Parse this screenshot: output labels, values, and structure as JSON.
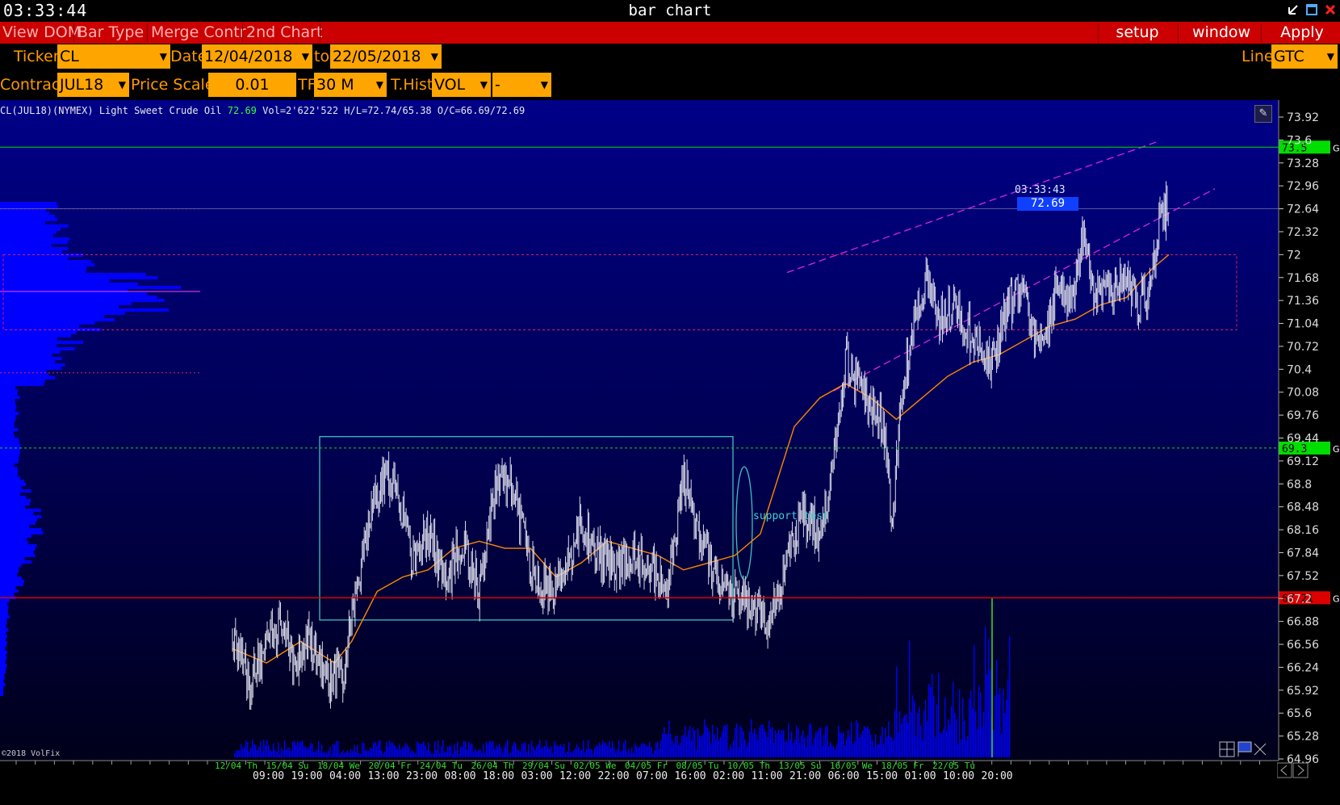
{
  "titlebar": {
    "clock": "03:33:44",
    "title": "bar chart"
  },
  "menubar": {
    "left_items": [
      "View DOM",
      "Bar Type",
      "Merge Contr",
      "2nd Chart"
    ],
    "setup_label": "setup",
    "window_label": "window",
    "apply_label": "Apply"
  },
  "controls": {
    "ticker_label": "Ticker",
    "ticker_value": "CL",
    "date_label": "Date",
    "date_from": "12/04/2018",
    "to_label": "to",
    "date_to": "22/05/2018",
    "line_label": "Line",
    "line_value": "GTC",
    "contract_label": "Contract",
    "contract_value": "JUL18",
    "price_scale_label": "Price Scale",
    "price_scale_value": "0.01",
    "tf_label": "TF",
    "tf_value": "30 M",
    "thist_label": "T.Hist",
    "thist_value": "VOL",
    "extra_value": "-"
  },
  "chart": {
    "info": {
      "symbol": "CL(JUL18)(NYMEX) Light Sweet Crude Oil",
      "last": "72.69",
      "rest": "Vol=2'622'522 H/L=72.74/65.38 O/C=66.69/72.69"
    },
    "copyright": "©2018 VolFix",
    "annotation": "support test",
    "last_time": "03:33:43",
    "last_price": "72.69",
    "colors": {
      "background_top": "#000080",
      "background_bottom": "#000018",
      "price": "#d8d8e8",
      "ma": "#ff8800",
      "volume": "#0000ff",
      "profile": "#0000ff",
      "box": "#40c0c0",
      "channel": "#dd22dd",
      "level_green": "#00dd00",
      "level_red": "#dd0000"
    }
  },
  "chart_data": {
    "type": "candlestick",
    "timeframe": "30 M",
    "y_ticks": [
      "73.92",
      "73.6",
      "73.28",
      "72.96",
      "72.64",
      "72.32",
      "72",
      "71.68",
      "71.36",
      "71.04",
      "70.72",
      "70.4",
      "70.08",
      "69.76",
      "69.44",
      "69.12",
      "68.8",
      "68.48",
      "68.16",
      "67.84",
      "67.52",
      "67.2",
      "66.88",
      "66.56",
      "66.24",
      "65.92",
      "65.6",
      "65.28",
      "64.96"
    ],
    "ylim": [
      64.96,
      73.92
    ],
    "x_date_labels": [
      "12/04 Th",
      "15/04 Su",
      "18/04 We",
      "20/04 Fr",
      "24/04 Tu",
      "26/04 Th",
      "29/04 Su",
      "02/05 We",
      "04/05 Fr",
      "08/05 Tu",
      "10/05 Th",
      "13/05 Su",
      "16/05 We",
      "18/05 Fr",
      "22/05 Tu"
    ],
    "x_time_labels": [
      "09:00",
      "19:00",
      "04:00",
      "13:00",
      "23:00",
      "08:00",
      "18:00",
      "03:00",
      "12:00",
      "22:00",
      "07:00",
      "16:00",
      "02:00",
      "11:00",
      "21:00",
      "06:00",
      "15:00",
      "01:00",
      "10:00",
      "20:00"
    ],
    "price_path": [
      [
        0.0,
        66.7
      ],
      [
        0.02,
        66.0
      ],
      [
        0.04,
        66.6
      ],
      [
        0.06,
        66.9
      ],
      [
        0.07,
        66.3
      ],
      [
        0.09,
        66.6
      ],
      [
        0.11,
        66.0
      ],
      [
        0.13,
        66.2
      ],
      [
        0.15,
        67.6
      ],
      [
        0.17,
        68.7
      ],
      [
        0.19,
        69.0
      ],
      [
        0.21,
        67.8
      ],
      [
        0.23,
        68.2
      ],
      [
        0.25,
        67.4
      ],
      [
        0.27,
        68.0
      ],
      [
        0.29,
        67.3
      ],
      [
        0.31,
        68.9
      ],
      [
        0.33,
        68.7
      ],
      [
        0.35,
        67.7
      ],
      [
        0.37,
        67.3
      ],
      [
        0.39,
        67.5
      ],
      [
        0.41,
        68.3
      ],
      [
        0.43,
        67.8
      ],
      [
        0.45,
        67.6
      ],
      [
        0.47,
        67.8
      ],
      [
        0.49,
        67.7
      ],
      [
        0.51,
        67.3
      ],
      [
        0.53,
        68.9
      ],
      [
        0.55,
        68.0
      ],
      [
        0.57,
        67.4
      ],
      [
        0.59,
        67.2
      ],
      [
        0.61,
        67.1
      ],
      [
        0.63,
        66.9
      ],
      [
        0.65,
        67.7
      ],
      [
        0.67,
        68.4
      ],
      [
        0.69,
        68.1
      ],
      [
        0.71,
        69.4
      ],
      [
        0.72,
        70.5
      ],
      [
        0.73,
        70.3
      ],
      [
        0.75,
        69.9
      ],
      [
        0.765,
        69.6
      ],
      [
        0.775,
        68.3
      ],
      [
        0.785,
        69.9
      ],
      [
        0.8,
        71.0
      ],
      [
        0.815,
        71.7
      ],
      [
        0.83,
        71.1
      ],
      [
        0.85,
        71.3
      ],
      [
        0.87,
        70.8
      ],
      [
        0.89,
        70.4
      ],
      [
        0.91,
        71.3
      ],
      [
        0.93,
        71.6
      ],
      [
        0.94,
        70.8
      ],
      [
        0.96,
        71.0
      ],
      [
        0.97,
        71.7
      ],
      [
        0.985,
        71.3
      ],
      [
        1.0,
        72.3
      ],
      [
        1.01,
        71.5
      ],
      [
        1.03,
        71.4
      ],
      [
        1.05,
        71.7
      ],
      [
        1.06,
        71.3
      ],
      [
        1.075,
        71.5
      ],
      [
        1.09,
        72.5
      ],
      [
        1.1,
        72.69
      ]
    ],
    "ma_path": [
      [
        0.0,
        66.5
      ],
      [
        0.04,
        66.3
      ],
      [
        0.08,
        66.6
      ],
      [
        0.12,
        66.3
      ],
      [
        0.14,
        66.6
      ],
      [
        0.17,
        67.3
      ],
      [
        0.2,
        67.5
      ],
      [
        0.23,
        67.6
      ],
      [
        0.26,
        67.9
      ],
      [
        0.29,
        68.0
      ],
      [
        0.32,
        67.9
      ],
      [
        0.35,
        67.9
      ],
      [
        0.38,
        67.5
      ],
      [
        0.41,
        67.7
      ],
      [
        0.44,
        68.0
      ],
      [
        0.47,
        67.9
      ],
      [
        0.5,
        67.8
      ],
      [
        0.53,
        67.6
      ],
      [
        0.56,
        67.7
      ],
      [
        0.59,
        67.8
      ],
      [
        0.62,
        68.1
      ],
      [
        0.66,
        69.6
      ],
      [
        0.69,
        70.0
      ],
      [
        0.72,
        70.2
      ],
      [
        0.75,
        70.0
      ],
      [
        0.78,
        69.7
      ],
      [
        0.81,
        70.0
      ],
      [
        0.84,
        70.3
      ],
      [
        0.87,
        70.5
      ],
      [
        0.9,
        70.6
      ],
      [
        0.93,
        70.8
      ],
      [
        0.96,
        71.0
      ],
      [
        0.99,
        71.1
      ],
      [
        1.02,
        71.3
      ],
      [
        1.05,
        71.4
      ],
      [
        1.08,
        71.8
      ],
      [
        1.1,
        72.0
      ]
    ],
    "levels": [
      {
        "price": 73.5,
        "label": "73.5",
        "style": "solid",
        "color": "#00dd00"
      },
      {
        "price": 69.3,
        "label": "69.3",
        "style": "dashed",
        "color": "#00dd00"
      },
      {
        "price": 67.21,
        "label": "67.21",
        "style": "solid",
        "color": "#dd0000"
      }
    ],
    "value_area": {
      "high": 72.0,
      "low": 70.95
    }
  }
}
